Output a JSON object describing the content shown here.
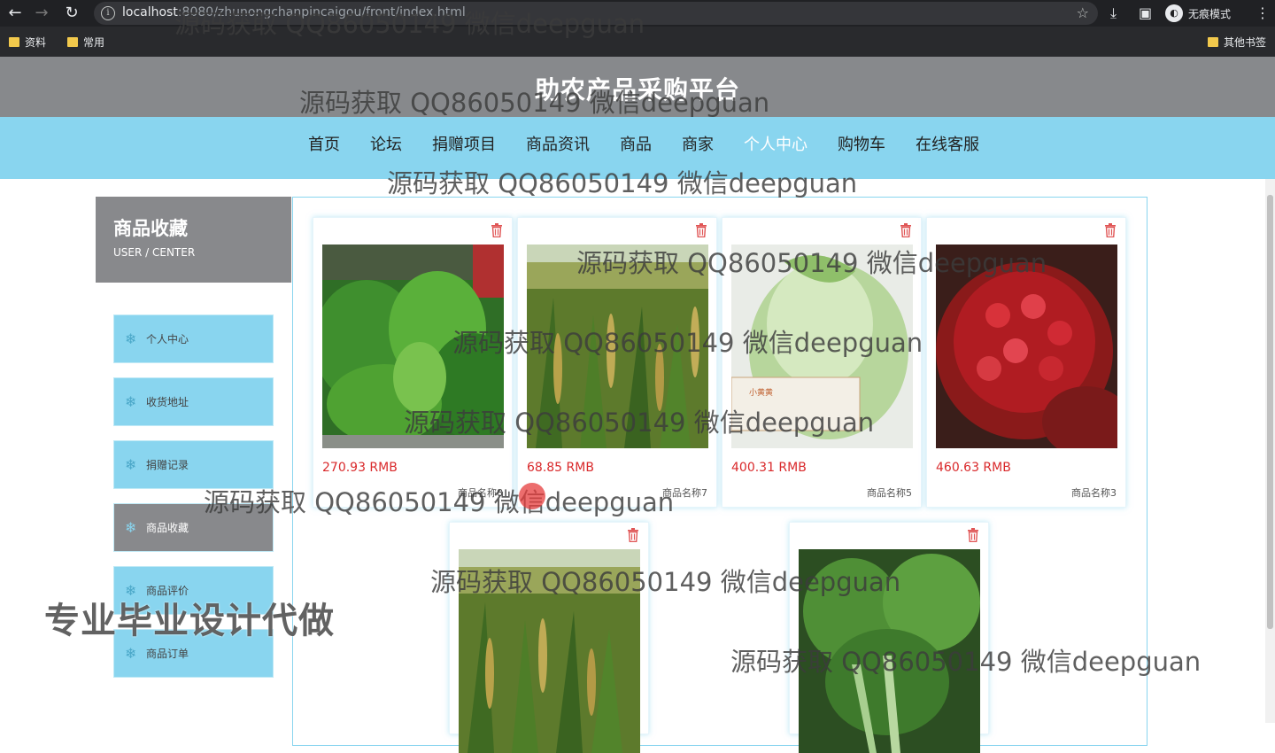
{
  "browser": {
    "url_host": "localhost",
    "url_path": ":8080/zhunongchanpincaigou/front/index.html",
    "incognito_label": "无痕模式",
    "bookmarks": [
      "资料",
      "常用"
    ],
    "other_bookmarks": "其他书签"
  },
  "site": {
    "title": "助农产品采购平台"
  },
  "nav": {
    "items": [
      "首页",
      "论坛",
      "捐赠项目",
      "商品资讯",
      "商品",
      "商家",
      "个人中心",
      "购物车",
      "在线客服"
    ],
    "active": "个人中心"
  },
  "sidebar": {
    "title": "商品收藏",
    "subtitle": "USER / CENTER",
    "items": [
      "个人中心",
      "收货地址",
      "捐赠记录",
      "商品收藏",
      "商品评价",
      "商品订单"
    ],
    "active": "商品收藏"
  },
  "products": [
    {
      "price": "270.93 RMB",
      "name": "商品名称8",
      "image": "leafy-greens"
    },
    {
      "price": "68.85 RMB",
      "name": "商品名称7",
      "image": "millet-field"
    },
    {
      "price": "400.31 RMB",
      "name": "商品名称5",
      "image": "cabbage"
    },
    {
      "price": "460.63 RMB",
      "name": "商品名称3",
      "image": "pomegranate"
    },
    {
      "price": "",
      "name": "",
      "image": "millet-field"
    },
    {
      "price": "",
      "name": "",
      "image": "bok-choy"
    }
  ],
  "watermarks": {
    "line": "源码获取 QQ86050149 微信deepguan",
    "banner": "专业毕业设计代做",
    "image_stamp": "小黄黄"
  },
  "colors": {
    "accent": "#89d5ef",
    "header_gray": "#87898c",
    "price_red": "#d9292b"
  }
}
